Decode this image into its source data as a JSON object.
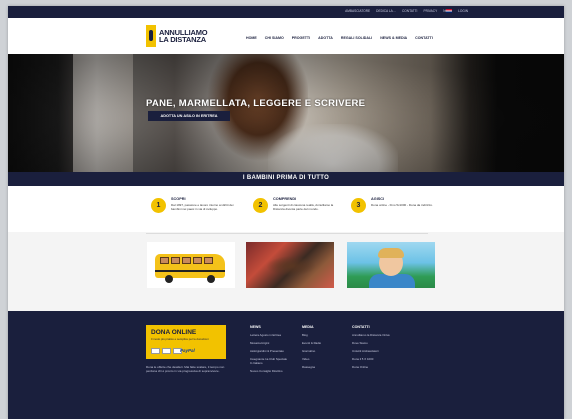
{
  "topbar": {
    "links": [
      "Ambasciatore",
      "Dedica la…",
      "Contatti",
      "Privacy",
      "Note",
      "Login"
    ],
    "flag": "uk-flag-icon"
  },
  "header": {
    "logo_line1": "ANNULLIAMO",
    "logo_line2": "LA DISTANZA",
    "nav": [
      "Home",
      "Chi siamo",
      "Progetti",
      "Adotta",
      "Regali solidali",
      "News & Media",
      "Contatti"
    ]
  },
  "hero": {
    "title": "Pane, marmellata, leggere e scrivere",
    "button": "Adotta un asilo in Eritrea"
  },
  "band": {
    "title": "I bambini prima di tutto"
  },
  "steps": [
    {
      "num": "1",
      "title": "Scopri",
      "text": "Dal 1997, passione e lavoro intorno ai diritti dei bambini nei paesi in via di sviluppo."
    },
    {
      "num": "2",
      "title": "Comprendi",
      "text": "Alle sorgenti di ciascuna realtà, Annulliamo la Distanza diventa parte del mondo."
    },
    {
      "num": "3",
      "title": "Agisci",
      "text": "Dona online - Fino 5x1000 - Dona da indirizzo."
    }
  ],
  "footer": {
    "donate_title": "Dona online",
    "donate_sub": "Il modo più pratico e semplice per le donazioni",
    "donate_paypal": "PayPal",
    "text": "Dona le offerte che desideri. Mai fatte scalare, il tempo non perdona chi è pronto in via progressiva di sopravvivere.",
    "columns": [
      {
        "title": "News",
        "items": [
          "Lettera Agosto in Eritrea",
          "Mosaico/origini",
          "Asilo/giardini & Presentato",
          "Insegnante 1a Club Speciale In Italiano",
          "Nuovo Consiglio Direttivo"
        ]
      },
      {
        "title": "Media",
        "items": [
          "Blog",
          "Eventi & Radio",
          "Giornalino",
          "Video",
          "Rassegna"
        ]
      },
      {
        "title": "Contatti",
        "items": [
          "Annulliamo la Distanza Onlus",
          "Dove Siamo",
          "Unisciti Ambasciatori",
          "Dona il 5 X 1000",
          "Dona Online"
        ]
      }
    ]
  },
  "colors": {
    "navy": "#1a1f3d",
    "accent_yellow": "#f2c200"
  }
}
